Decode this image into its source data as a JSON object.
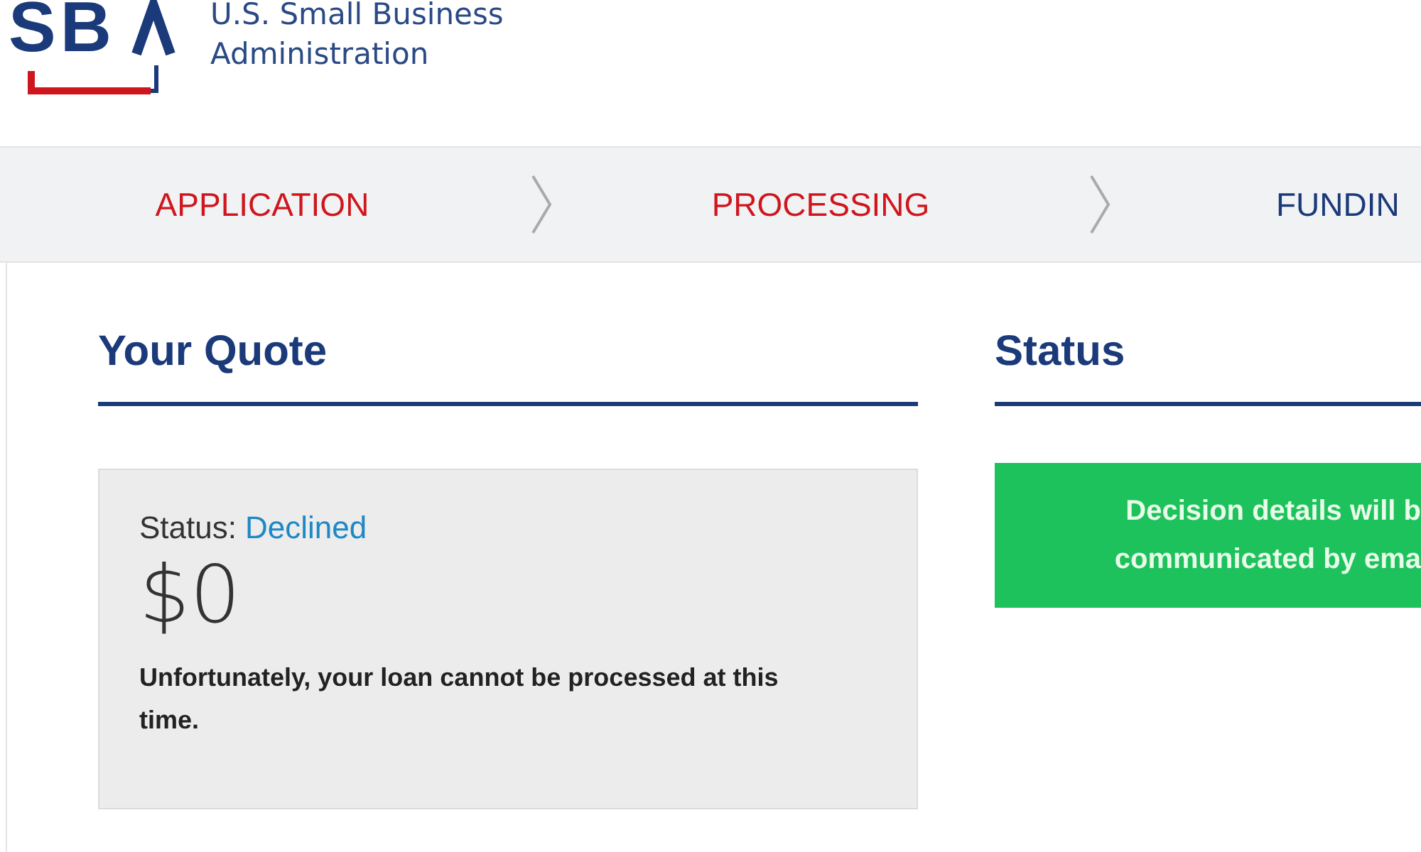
{
  "header": {
    "logo_text": "SB",
    "agency_name": [
      "U.S. Small Business",
      "Administration"
    ]
  },
  "steps": [
    {
      "label": "APPLICATION",
      "reached": true
    },
    {
      "label": "PROCESSING",
      "reached": true
    },
    {
      "label": "FUNDIN",
      "reached": false
    }
  ],
  "quote": {
    "heading": "Your Quote",
    "status_label": "Status:",
    "status_value": "Declined",
    "amount": "$0",
    "message": "Unfortunately, your loan cannot be processed at this time."
  },
  "status": {
    "heading": "Status",
    "notice_lines": [
      "Decision details will b",
      "communicated by ema"
    ]
  }
}
